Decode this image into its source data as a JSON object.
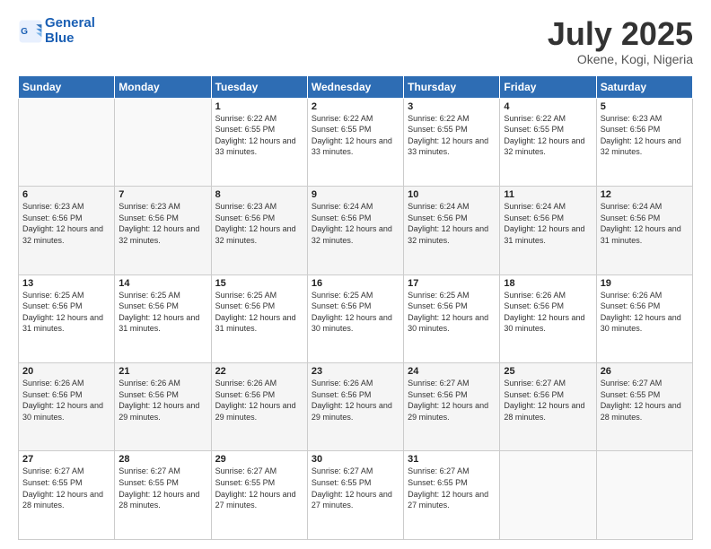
{
  "header": {
    "logo_line1": "General",
    "logo_line2": "Blue",
    "month_year": "July 2025",
    "location": "Okene, Kogi, Nigeria"
  },
  "weekdays": [
    "Sunday",
    "Monday",
    "Tuesday",
    "Wednesday",
    "Thursday",
    "Friday",
    "Saturday"
  ],
  "weeks": [
    [
      {
        "day": "",
        "sunrise": "",
        "sunset": "",
        "daylight": ""
      },
      {
        "day": "",
        "sunrise": "",
        "sunset": "",
        "daylight": ""
      },
      {
        "day": "1",
        "sunrise": "Sunrise: 6:22 AM",
        "sunset": "Sunset: 6:55 PM",
        "daylight": "Daylight: 12 hours and 33 minutes."
      },
      {
        "day": "2",
        "sunrise": "Sunrise: 6:22 AM",
        "sunset": "Sunset: 6:55 PM",
        "daylight": "Daylight: 12 hours and 33 minutes."
      },
      {
        "day": "3",
        "sunrise": "Sunrise: 6:22 AM",
        "sunset": "Sunset: 6:55 PM",
        "daylight": "Daylight: 12 hours and 33 minutes."
      },
      {
        "day": "4",
        "sunrise": "Sunrise: 6:22 AM",
        "sunset": "Sunset: 6:55 PM",
        "daylight": "Daylight: 12 hours and 32 minutes."
      },
      {
        "day": "5",
        "sunrise": "Sunrise: 6:23 AM",
        "sunset": "Sunset: 6:56 PM",
        "daylight": "Daylight: 12 hours and 32 minutes."
      }
    ],
    [
      {
        "day": "6",
        "sunrise": "Sunrise: 6:23 AM",
        "sunset": "Sunset: 6:56 PM",
        "daylight": "Daylight: 12 hours and 32 minutes."
      },
      {
        "day": "7",
        "sunrise": "Sunrise: 6:23 AM",
        "sunset": "Sunset: 6:56 PM",
        "daylight": "Daylight: 12 hours and 32 minutes."
      },
      {
        "day": "8",
        "sunrise": "Sunrise: 6:23 AM",
        "sunset": "Sunset: 6:56 PM",
        "daylight": "Daylight: 12 hours and 32 minutes."
      },
      {
        "day": "9",
        "sunrise": "Sunrise: 6:24 AM",
        "sunset": "Sunset: 6:56 PM",
        "daylight": "Daylight: 12 hours and 32 minutes."
      },
      {
        "day": "10",
        "sunrise": "Sunrise: 6:24 AM",
        "sunset": "Sunset: 6:56 PM",
        "daylight": "Daylight: 12 hours and 32 minutes."
      },
      {
        "day": "11",
        "sunrise": "Sunrise: 6:24 AM",
        "sunset": "Sunset: 6:56 PM",
        "daylight": "Daylight: 12 hours and 31 minutes."
      },
      {
        "day": "12",
        "sunrise": "Sunrise: 6:24 AM",
        "sunset": "Sunset: 6:56 PM",
        "daylight": "Daylight: 12 hours and 31 minutes."
      }
    ],
    [
      {
        "day": "13",
        "sunrise": "Sunrise: 6:25 AM",
        "sunset": "Sunset: 6:56 PM",
        "daylight": "Daylight: 12 hours and 31 minutes."
      },
      {
        "day": "14",
        "sunrise": "Sunrise: 6:25 AM",
        "sunset": "Sunset: 6:56 PM",
        "daylight": "Daylight: 12 hours and 31 minutes."
      },
      {
        "day": "15",
        "sunrise": "Sunrise: 6:25 AM",
        "sunset": "Sunset: 6:56 PM",
        "daylight": "Daylight: 12 hours and 31 minutes."
      },
      {
        "day": "16",
        "sunrise": "Sunrise: 6:25 AM",
        "sunset": "Sunset: 6:56 PM",
        "daylight": "Daylight: 12 hours and 30 minutes."
      },
      {
        "day": "17",
        "sunrise": "Sunrise: 6:25 AM",
        "sunset": "Sunset: 6:56 PM",
        "daylight": "Daylight: 12 hours and 30 minutes."
      },
      {
        "day": "18",
        "sunrise": "Sunrise: 6:26 AM",
        "sunset": "Sunset: 6:56 PM",
        "daylight": "Daylight: 12 hours and 30 minutes."
      },
      {
        "day": "19",
        "sunrise": "Sunrise: 6:26 AM",
        "sunset": "Sunset: 6:56 PM",
        "daylight": "Daylight: 12 hours and 30 minutes."
      }
    ],
    [
      {
        "day": "20",
        "sunrise": "Sunrise: 6:26 AM",
        "sunset": "Sunset: 6:56 PM",
        "daylight": "Daylight: 12 hours and 30 minutes."
      },
      {
        "day": "21",
        "sunrise": "Sunrise: 6:26 AM",
        "sunset": "Sunset: 6:56 PM",
        "daylight": "Daylight: 12 hours and 29 minutes."
      },
      {
        "day": "22",
        "sunrise": "Sunrise: 6:26 AM",
        "sunset": "Sunset: 6:56 PM",
        "daylight": "Daylight: 12 hours and 29 minutes."
      },
      {
        "day": "23",
        "sunrise": "Sunrise: 6:26 AM",
        "sunset": "Sunset: 6:56 PM",
        "daylight": "Daylight: 12 hours and 29 minutes."
      },
      {
        "day": "24",
        "sunrise": "Sunrise: 6:27 AM",
        "sunset": "Sunset: 6:56 PM",
        "daylight": "Daylight: 12 hours and 29 minutes."
      },
      {
        "day": "25",
        "sunrise": "Sunrise: 6:27 AM",
        "sunset": "Sunset: 6:56 PM",
        "daylight": "Daylight: 12 hours and 28 minutes."
      },
      {
        "day": "26",
        "sunrise": "Sunrise: 6:27 AM",
        "sunset": "Sunset: 6:55 PM",
        "daylight": "Daylight: 12 hours and 28 minutes."
      }
    ],
    [
      {
        "day": "27",
        "sunrise": "Sunrise: 6:27 AM",
        "sunset": "Sunset: 6:55 PM",
        "daylight": "Daylight: 12 hours and 28 minutes."
      },
      {
        "day": "28",
        "sunrise": "Sunrise: 6:27 AM",
        "sunset": "Sunset: 6:55 PM",
        "daylight": "Daylight: 12 hours and 28 minutes."
      },
      {
        "day": "29",
        "sunrise": "Sunrise: 6:27 AM",
        "sunset": "Sunset: 6:55 PM",
        "daylight": "Daylight: 12 hours and 27 minutes."
      },
      {
        "day": "30",
        "sunrise": "Sunrise: 6:27 AM",
        "sunset": "Sunset: 6:55 PM",
        "daylight": "Daylight: 12 hours and 27 minutes."
      },
      {
        "day": "31",
        "sunrise": "Sunrise: 6:27 AM",
        "sunset": "Sunset: 6:55 PM",
        "daylight": "Daylight: 12 hours and 27 minutes."
      },
      {
        "day": "",
        "sunrise": "",
        "sunset": "",
        "daylight": ""
      },
      {
        "day": "",
        "sunrise": "",
        "sunset": "",
        "daylight": ""
      }
    ]
  ]
}
